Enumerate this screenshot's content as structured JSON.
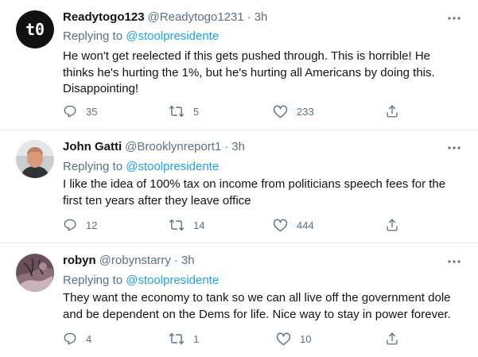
{
  "tweets": [
    {
      "display_name": "Readytogo123",
      "handle": "@Readytogo1231",
      "separator": "·",
      "time": "3h",
      "replying_prefix": "Replying to",
      "replying_to": "@stoolpresidente",
      "avatar_text": "t0",
      "body_lines": [
        "He won't get reelected if this gets pushed through.  This is horrible!  He",
        "thinks he's hurting the 1%, but he's hurting all Americans by doing this.",
        "Disappointing!"
      ],
      "replies": "35",
      "retweets": "5",
      "likes": "233"
    },
    {
      "display_name": "John Gatti",
      "handle": "@Brooklynreport1",
      "separator": "·",
      "time": "3h",
      "replying_prefix": "Replying to",
      "replying_to": "@stoolpresidente",
      "body_lines": [
        "I like the idea of 100% tax on income from politicians speech fees for the",
        "first ten years after they leave office"
      ],
      "replies": "12",
      "retweets": "14",
      "likes": "444"
    },
    {
      "display_name": "robyn",
      "handle": "@robynstarry",
      "separator": "·",
      "time": "3h",
      "replying_prefix": "Replying to",
      "replying_to": "@stoolpresidente",
      "body_lines": [
        "They want the economy to tank so we can all live off the government dole",
        "and be dependent on the Dems for life.  Nice way to stay in power forever."
      ],
      "replies": "4",
      "retweets": "1",
      "likes": "10"
    }
  ],
  "colors": {
    "text": "#0f1419",
    "secondary": "#5b7083",
    "link": "#1da1f2",
    "divider": "#e6ecf0"
  },
  "icons": [
    "more-icon",
    "reply-icon",
    "retweet-icon",
    "like-icon",
    "share-icon"
  ]
}
